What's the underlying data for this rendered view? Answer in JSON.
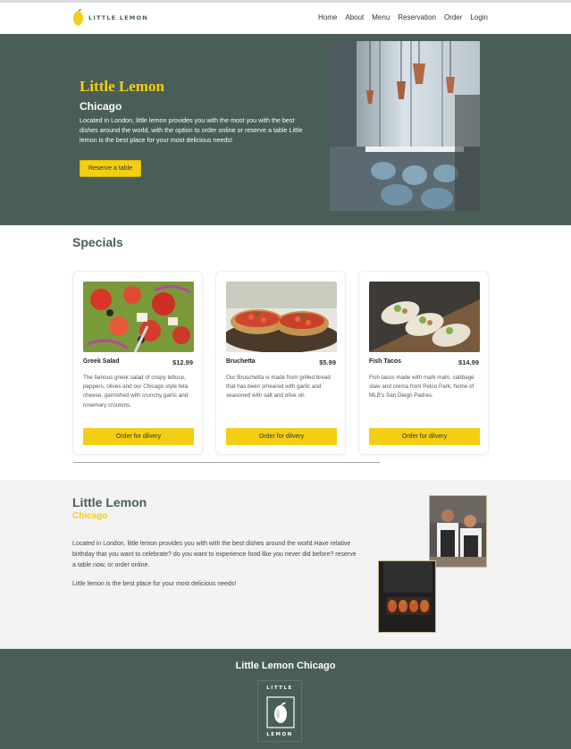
{
  "nav": {
    "logo_text": "LITTLE LEMON",
    "links": [
      "Home",
      "About",
      "Menu",
      "Reservation",
      "Order",
      "Login"
    ]
  },
  "hero": {
    "title": "Little Lemon",
    "city": "Chicago",
    "description": "Located in London, little lemon provides you with the most you with the best dishes around the world, with the option to order online or reserve a table Little lemon is the best place for your most delicious needs!",
    "cta": "Reserve a table"
  },
  "specials": {
    "title": "Specials",
    "items": [
      {
        "name": "Greek Salad",
        "price": "$12.99",
        "description": "The famous greek salad of crispy lettuce, peppers, olives and our Chicago style feta cheese, garnished with crunchy garlic and rosemary croutons.",
        "button": "Order for dilvery"
      },
      {
        "name": "Bruchetta",
        "price": "$5.99",
        "description": "Our Bruschetta is made from grilled bread that has been smeared with garlic and seasoned with salt and olive oil.",
        "button": "Order for dilvery"
      },
      {
        "name": "Fish Tacos",
        "price": "$14.99",
        "description": "Fish tacos made with mahi mahi, cabbage slaw and crema from Petco Park, home of MLB's San Diego Padres.",
        "button": "Order for dilvery"
      }
    ]
  },
  "about": {
    "title": "Little Lemon",
    "city": "Chicago",
    "paragraph1": "Located in London, little lemon provides you with with the best dishes around the world.Have relative birthday that you want to celebrate? do you want to experience food like you never did before? reserve a table now, or order online.",
    "paragraph2": "Little lemon is the best place for your most delicious needs!"
  },
  "footer": {
    "title": "Little Lemon Chicago",
    "logo_top": "LITTLE",
    "logo_bottom": "LEMON"
  },
  "colors": {
    "primary_green": "#495e57",
    "primary_yellow": "#f4ce14"
  }
}
